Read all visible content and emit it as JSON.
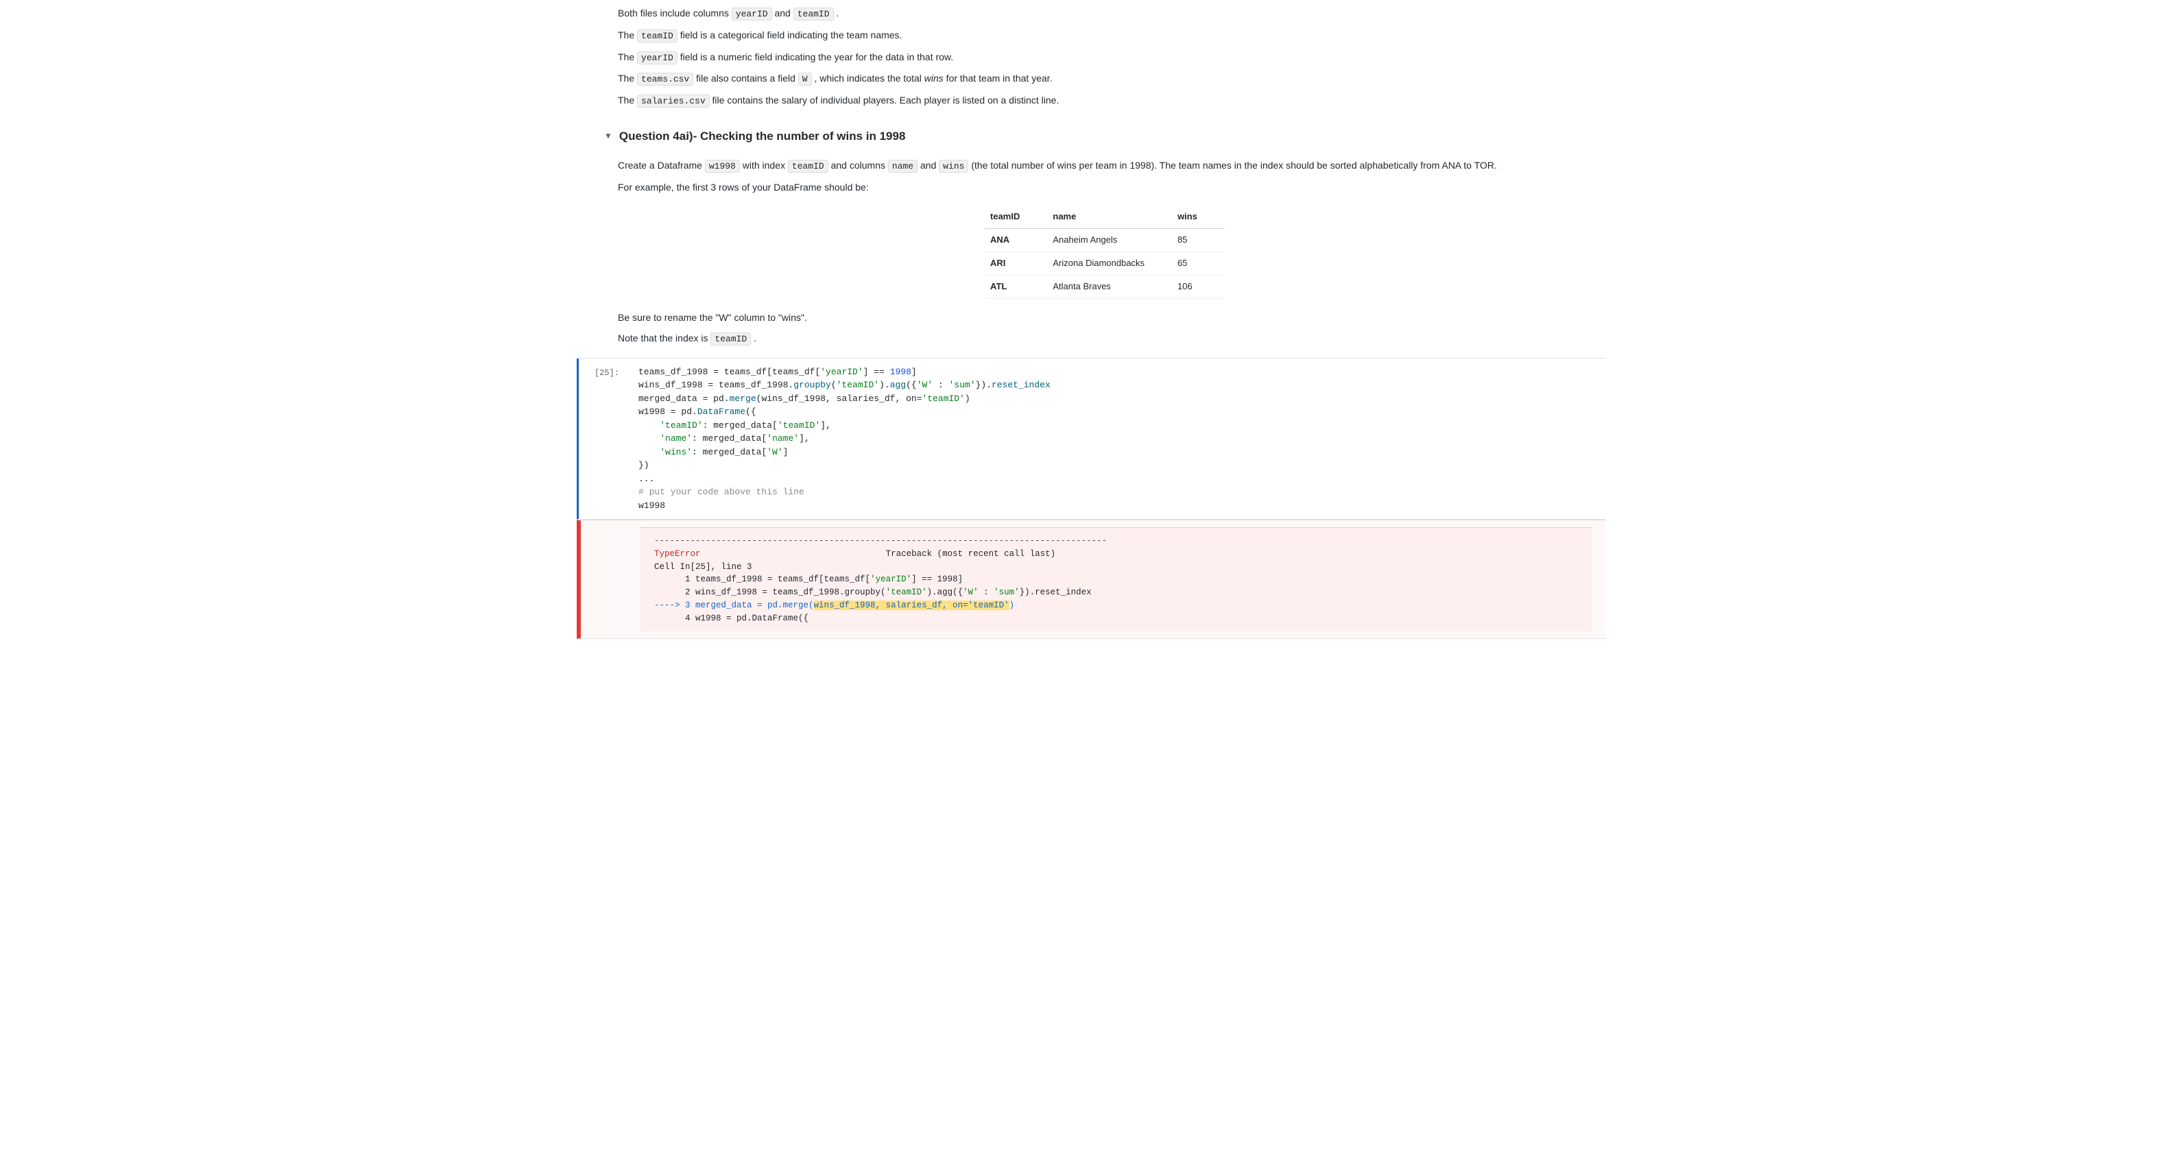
{
  "intro_texts": [
    {
      "id": "line1",
      "text_before": "Both files include columns ",
      "codes": [
        "yearID",
        "teamID"
      ],
      "text_middle": " and ",
      "text_after": "."
    }
  ],
  "para2": {
    "before": "The ",
    "code": "teamID",
    "after": " field is a categorical field indicating the team names."
  },
  "para3": {
    "before": "The ",
    "code": "yearID",
    "after": " field is a numeric field indicating the year for the data in that row."
  },
  "para4": {
    "before": "The ",
    "code": "teams.csv",
    "after_before_italic": " file also contains a field ",
    "code2": "W",
    "after_italic": " , which indicates the total ",
    "italic": "wins",
    "after": " for that team in that year."
  },
  "para5": {
    "before": "The ",
    "code": "salaries.csv",
    "after": " file contains the salary of individual players. Each player is listed on a distinct line."
  },
  "section_title": "Question 4ai)- Checking the number of wins in 1998",
  "section_desc1": {
    "before": "Create a Dataframe ",
    "code": "w1998",
    "middle": " with index ",
    "code2": "teamID",
    "middle2": " and columns ",
    "code3": "name",
    "middle3": " and ",
    "code4": "wins",
    "after": " (the total number of wins per team in 1998). The team names in the index should be sorted alphabetically from ANA to TOR."
  },
  "section_desc2": "For example, the first 3 rows of your DataFrame should be:",
  "table": {
    "headers": [
      "teamID",
      "name",
      "wins"
    ],
    "rows": [
      [
        "ANA",
        "Anaheim Angels",
        "85"
      ],
      [
        "ARI",
        "Arizona Diamondbacks",
        "65"
      ],
      [
        "ATL",
        "Atlanta Braves",
        "106"
      ]
    ]
  },
  "rename_note": "Be sure to rename the \"W\" column to \"wins\".",
  "index_note": {
    "before": "Note that the index is ",
    "code": "teamID",
    "after": "."
  },
  "cell_label": "[25]:",
  "code_lines": [
    {
      "parts": [
        {
          "type": "normal",
          "text": "teams_df_1998 = teams_df[teams_df["
        },
        {
          "type": "string",
          "text": "'yearID'"
        },
        {
          "type": "normal",
          "text": "] == "
        },
        {
          "type": "num",
          "text": "1998"
        },
        {
          "type": "normal",
          "text": "]"
        }
      ]
    },
    {
      "parts": [
        {
          "type": "normal",
          "text": "wins_df_1998 = teams_df_1998."
        },
        {
          "type": "method",
          "text": "groupby"
        },
        {
          "type": "normal",
          "text": "("
        },
        {
          "type": "string",
          "text": "'teamID'"
        },
        {
          "type": "normal",
          "text": ")."
        },
        {
          "type": "method",
          "text": "agg"
        },
        {
          "type": "normal",
          "text": "({"
        },
        {
          "type": "string",
          "text": "'W'"
        },
        {
          "type": "normal",
          "text": " : "
        },
        {
          "type": "string",
          "text": "'sum'"
        },
        {
          "type": "normal",
          "text": "})."
        },
        {
          "type": "method",
          "text": "reset_index"
        }
      ]
    },
    {
      "parts": [
        {
          "type": "normal",
          "text": "merged_data = pd."
        },
        {
          "type": "method",
          "text": "merge"
        },
        {
          "type": "normal",
          "text": "(wins_df_1998, salaries_df, on="
        },
        {
          "type": "string",
          "text": "'teamID'"
        },
        {
          "type": "normal",
          "text": ")"
        }
      ]
    },
    {
      "parts": [
        {
          "type": "normal",
          "text": "w1998 = pd."
        },
        {
          "type": "method",
          "text": "DataFrame"
        },
        {
          "type": "normal",
          "text": "({"
        }
      ]
    },
    {
      "parts": [
        {
          "type": "normal",
          "text": "    "
        },
        {
          "type": "string",
          "text": "'teamID'"
        },
        {
          "type": "normal",
          "text": ": merged_data["
        },
        {
          "type": "string",
          "text": "'teamID'"
        },
        {
          "type": "normal",
          "text": "],"
        }
      ]
    },
    {
      "parts": [
        {
          "type": "normal",
          "text": "    "
        },
        {
          "type": "string",
          "text": "'name'"
        },
        {
          "type": "normal",
          "text": ": merged_data["
        },
        {
          "type": "string",
          "text": "'name'"
        },
        {
          "type": "normal",
          "text": "],"
        }
      ]
    },
    {
      "parts": [
        {
          "type": "normal",
          "text": "    "
        },
        {
          "type": "string",
          "text": "'wins'"
        },
        {
          "type": "normal",
          "text": ": merged_data["
        },
        {
          "type": "string",
          "text": "'W'"
        },
        {
          "type": "normal",
          "text": "]"
        }
      ]
    },
    {
      "parts": [
        {
          "type": "normal",
          "text": "})"
        }
      ]
    },
    {
      "parts": [
        {
          "type": "normal",
          "text": "..."
        }
      ]
    },
    {
      "parts": [
        {
          "type": "comment",
          "text": "# put your code above this line"
        }
      ]
    },
    {
      "parts": [
        {
          "type": "normal",
          "text": "w1998"
        }
      ]
    }
  ],
  "error_header_dashes": "----------------------------------------------------------------------------------------",
  "error_type": "TypeError",
  "error_traceback": "                                    Traceback (most recent call last)",
  "error_cell_ref": "Cell In[25], line 3",
  "error_lines": [
    "      1 teams_df_1998 = teams_df[teams_df['yearID'] == 1998]",
    "      2 wins_df_1998 = teams_df_1998.groupby('teamID').agg({'W' : 'sum'}).reset_index",
    "----> 3 merged_data = pd.merge(wins_df_1998, salaries_df, on='teamID')",
    "      4 w1998 = pd.DataFrame({"
  ],
  "error_highlight_start": "pd.merge(wins_df_1998, salaries_df, on='teamID')",
  "colors": {
    "accent_blue": "#1565c0",
    "error_red": "#e53935",
    "error_bg": "#fff0f0",
    "highlight_yellow": "#ffe082",
    "table_header_border": "#ccc"
  }
}
